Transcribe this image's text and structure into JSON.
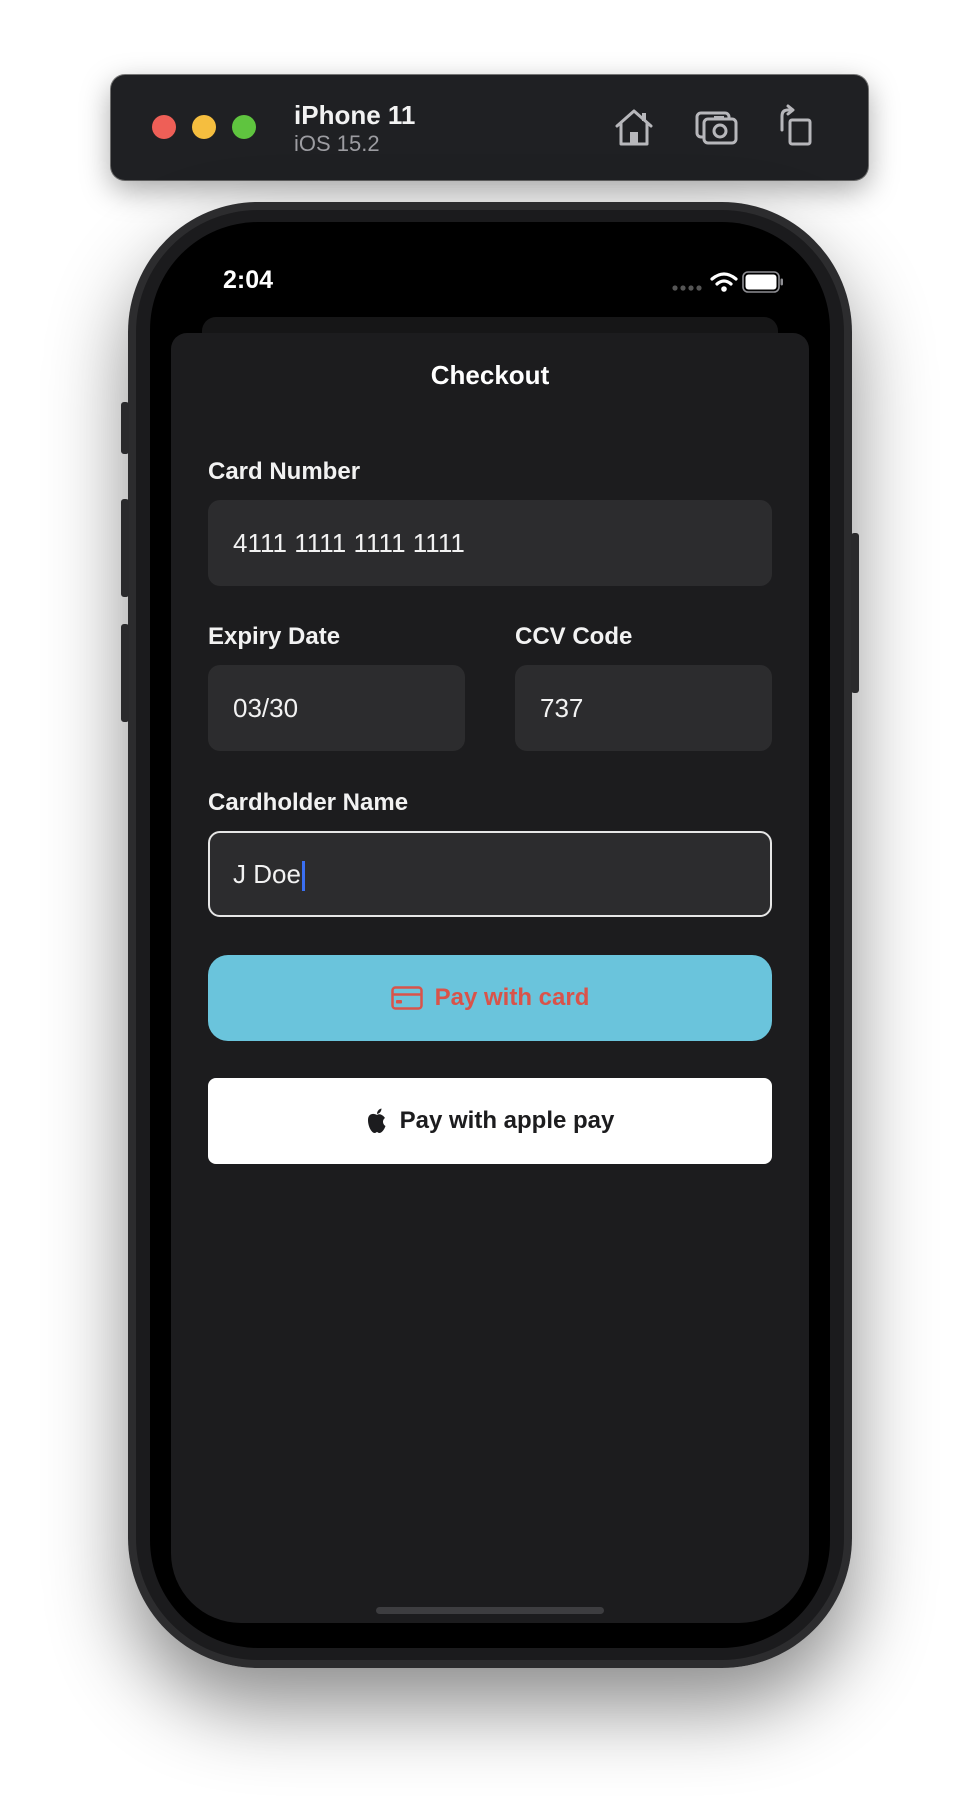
{
  "simulator": {
    "device_name": "iPhone 11",
    "os_version": "iOS 15.2",
    "traffic_lights": [
      "close",
      "minimize",
      "zoom"
    ],
    "toolbar_icons": [
      "home-icon",
      "screenshot-icon",
      "rotate-icon"
    ]
  },
  "status_bar": {
    "time": "2:04",
    "icons": [
      "signal-dots-icon",
      "wifi-icon",
      "battery-icon"
    ]
  },
  "checkout": {
    "title": "Checkout",
    "card_number": {
      "label": "Card Number",
      "value": "4111 1111 1111 1111"
    },
    "expiry": {
      "label": "Expiry Date",
      "value": "03/30"
    },
    "ccv": {
      "label": "CCV Code",
      "value": "737"
    },
    "cardholder": {
      "label": "Cardholder Name",
      "value": "J Doe",
      "focused": true
    },
    "pay_card_button": {
      "label": "Pay with card",
      "icon": "credit-card-icon",
      "background": "#6ac4dc",
      "text_color": "#d9534a"
    },
    "pay_apple_button": {
      "label": "Pay with apple pay",
      "icon": "apple-logo-icon",
      "background": "#ffffff",
      "text_color": "#1c1c1e"
    }
  },
  "colors": {
    "sheet_background": "#1c1c1e",
    "field_background": "#2c2c2e",
    "caret": "#3a6ff2"
  }
}
